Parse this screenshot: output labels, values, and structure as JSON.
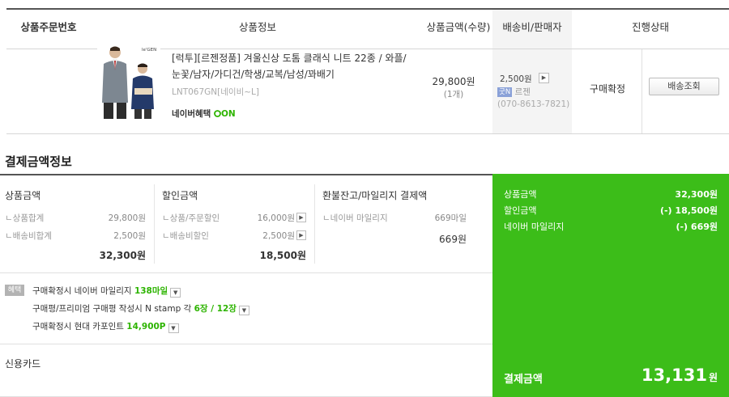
{
  "table": {
    "headers": {
      "order_no": "상품주문번호",
      "product_info": "상품정보",
      "price_qty": "상품금액(수량)",
      "shipping_seller": "배송비/판매자",
      "status": "진행상태"
    },
    "product": {
      "title": "[럭투][르젠정품] 겨울신상 도톰 클래식 니트 22종 / 와플/눈꽃/남자/가디건/학생/교복/남성/꽈배기",
      "code": "LNT067GN[네이비~L]",
      "naver_benefit": "네이버혜택",
      "naver_benefit_on": "ON",
      "image_brand": "le'GEN",
      "price": "29,800원",
      "qty": "(1개)"
    },
    "shipping": {
      "fee": "2,500원",
      "seller_badge": "굿N",
      "seller_name": "르젠",
      "phone": "(070-8613-7821)"
    },
    "status": {
      "text": "구매확정",
      "track_button": "배송조회"
    }
  },
  "payment": {
    "title": "결제금액정보",
    "product_col": {
      "header": "상품금액",
      "rows": [
        {
          "label": "ㄴ상품합계",
          "value": "29,800원"
        },
        {
          "label": "ㄴ배송비합계",
          "value": "2,500원"
        }
      ],
      "total": "32,300원"
    },
    "discount_col": {
      "header": "할인금액",
      "rows": [
        {
          "label": "ㄴ상품/주문할인",
          "value": "16,000원"
        },
        {
          "label": "ㄴ배송비할인",
          "value": "2,500원"
        }
      ],
      "total": "18,500원"
    },
    "refund_col": {
      "header": "환불잔고/마일리지 결제액",
      "rows": [
        {
          "label": "ㄴ네이버 마일리지",
          "value": "669마일"
        }
      ],
      "total": "669원"
    },
    "benefits": {
      "tag": "혜택",
      "row1_prefix": "구매확정시 네이버 마일리지 ",
      "row1_value": "138마일",
      "row2_prefix": "구매평/프리미엄 구매평 작성시 N stamp 각 ",
      "row2_value": "6장 / 12장",
      "row3_prefix": "구매확정시 현대 카포인트 ",
      "row3_value": "14,900P"
    },
    "method": "신용카드",
    "summary": {
      "product_label": "상품금액",
      "product_value": "32,300원",
      "discount_label": "할인금액",
      "discount_value": "(-) 18,500원",
      "mileage_label": "네이버 마일리지",
      "mileage_value": "(-) 669원",
      "final_label": "결제금액",
      "final_value": "13,131",
      "final_unit": "원"
    },
    "colors": {
      "green_panel": "#3cbd19",
      "accent_green": "#2db400"
    }
  }
}
